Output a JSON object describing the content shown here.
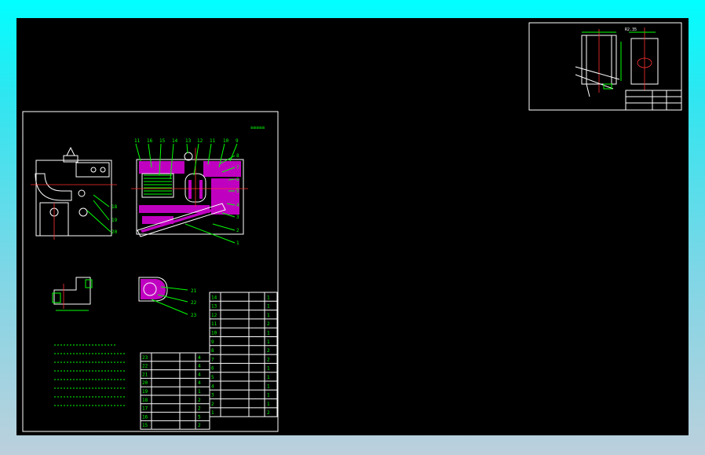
{
  "main_view": {
    "balloon_numbers": [
      "11",
      "16",
      "15",
      "14",
      "13",
      "12",
      "11",
      "10",
      "9",
      "8",
      "7",
      "6",
      "5",
      "4",
      "3",
      "2",
      "1"
    ],
    "left_callouts": [
      "18",
      "19",
      "20"
    ],
    "section_callouts": [
      "21",
      "22",
      "23"
    ]
  },
  "bom_right": [
    {
      "no": "14",
      "qty": "1"
    },
    {
      "no": "13",
      "qty": "1"
    },
    {
      "no": "12",
      "qty": "1"
    },
    {
      "no": "11",
      "qty": "2"
    },
    {
      "no": "10",
      "qty": "1"
    },
    {
      "no": "9",
      "qty": "1"
    },
    {
      "no": "8",
      "qty": "2"
    },
    {
      "no": "7",
      "qty": "2"
    },
    {
      "no": "6",
      "qty": "1"
    },
    {
      "no": "5",
      "qty": "1"
    },
    {
      "no": "4",
      "qty": "1"
    },
    {
      "no": "3",
      "qty": "1"
    },
    {
      "no": "2",
      "qty": "1"
    },
    {
      "no": "1",
      "qty": "2"
    }
  ],
  "bom_left": [
    {
      "no": "23",
      "qty": "4"
    },
    {
      "no": "22",
      "qty": "4"
    },
    {
      "no": "21",
      "qty": "4"
    },
    {
      "no": "20",
      "qty": "4"
    },
    {
      "no": "19",
      "qty": "1"
    },
    {
      "no": "18",
      "qty": "2"
    },
    {
      "no": "17",
      "qty": "2"
    },
    {
      "no": "16",
      "qty": "5"
    },
    {
      "no": "15",
      "qty": "2"
    }
  ],
  "colors": {
    "background": "#000000",
    "line": "#ffffff",
    "annotation": "#00ff00",
    "centerline": "#ff3030",
    "section_fill": "#c000c0",
    "frame_top": "#00ffff"
  }
}
